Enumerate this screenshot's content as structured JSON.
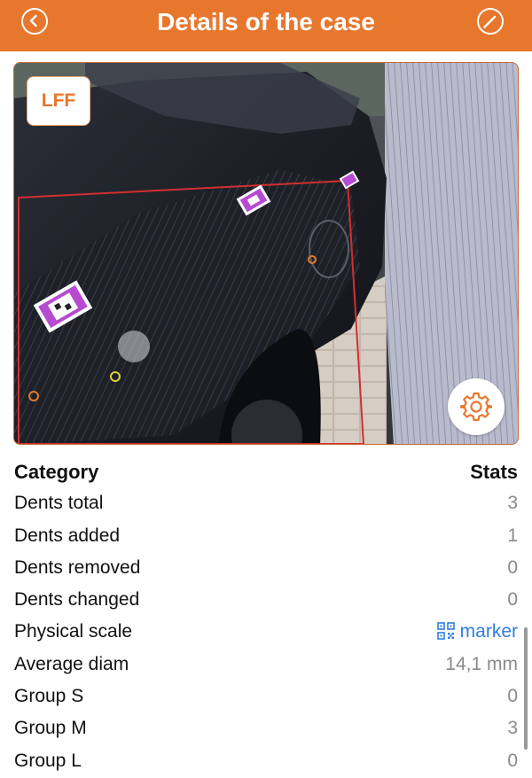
{
  "header": {
    "title": "Details of the case"
  },
  "photo": {
    "badge": "LFF"
  },
  "stats": {
    "category_header": "Category",
    "stats_header": "Stats",
    "rows": [
      {
        "label": "Dents total",
        "value": "3"
      },
      {
        "label": "Dents added",
        "value": "1"
      },
      {
        "label": "Dents removed",
        "value": "0"
      },
      {
        "label": "Dents changed",
        "value": "0"
      },
      {
        "label": "Physical scale",
        "value": "marker"
      },
      {
        "label": "Average diam",
        "value": "14,1 mm"
      },
      {
        "label": "Group S",
        "value": "0"
      },
      {
        "label": "Group M",
        "value": "3"
      },
      {
        "label": "Group L",
        "value": "0"
      }
    ]
  },
  "icons": {
    "back": "chevron-left-circle-icon",
    "edit": "pencil-circle-icon",
    "settings": "gear-icon",
    "scale": "qr-code-icon"
  },
  "colors": {
    "accent": "#E8772E",
    "link": "#2f7de1",
    "value": "#8a8a8a"
  }
}
